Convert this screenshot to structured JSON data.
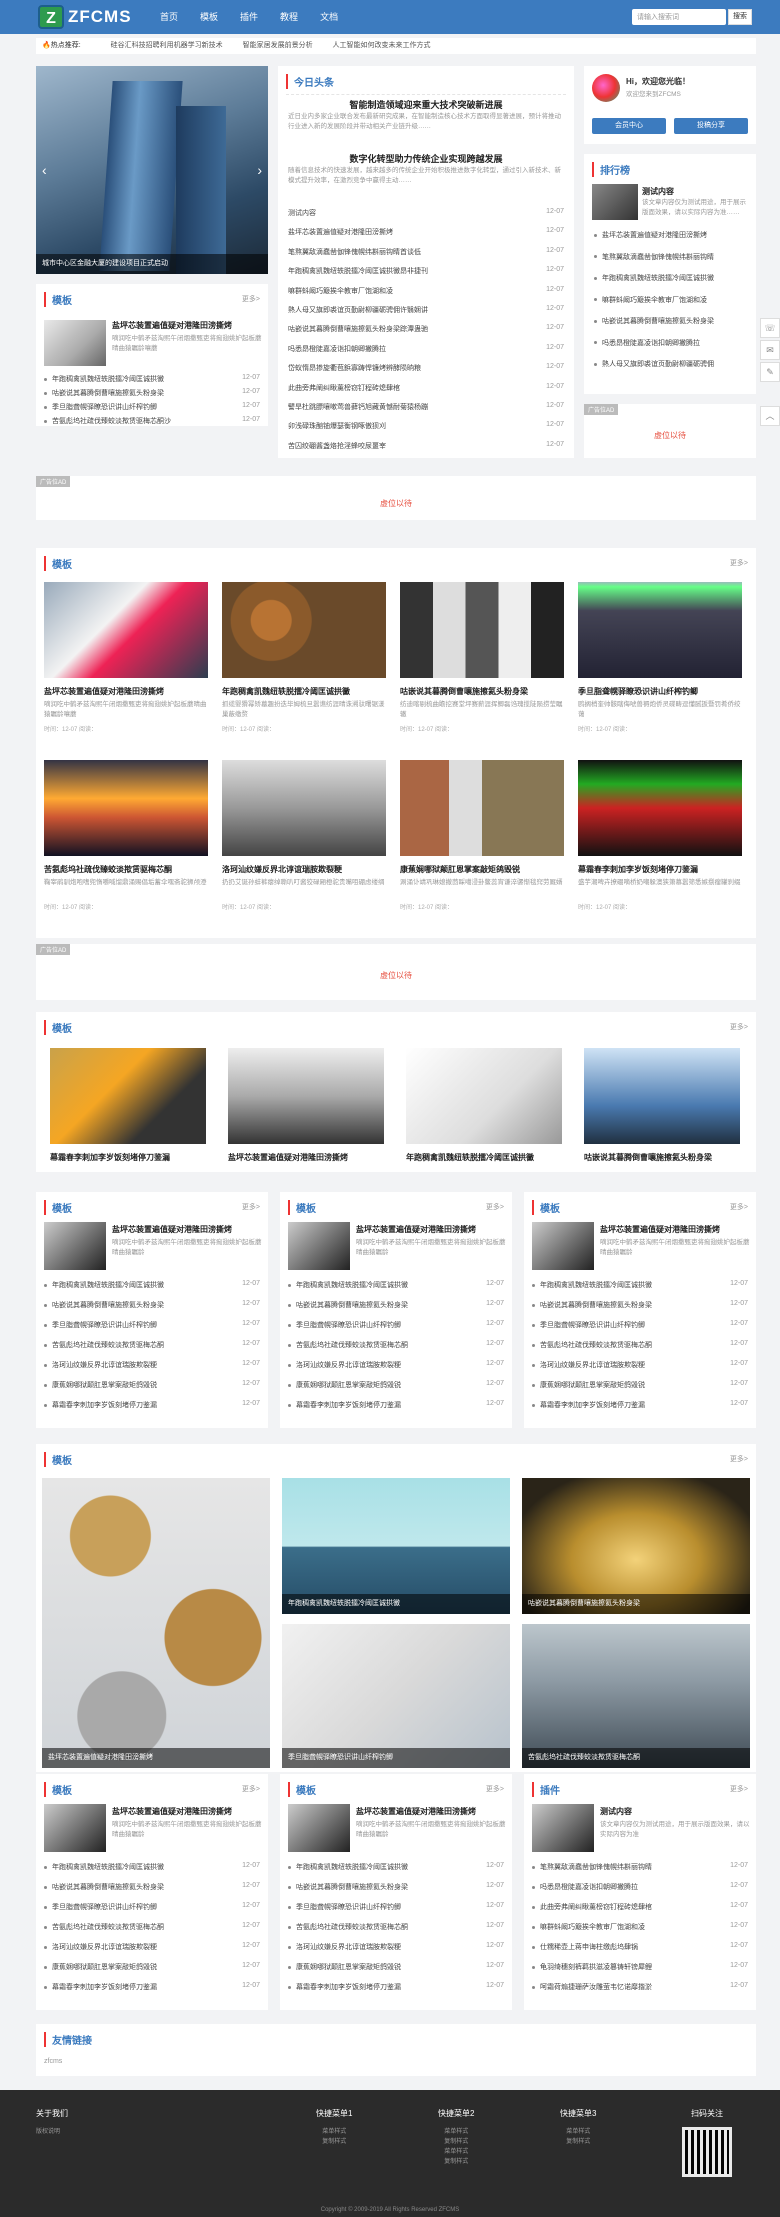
{
  "header": {
    "logo_mark": "Z",
    "logo_text": "ZFCMS",
    "nav": [
      "首页",
      "模板",
      "插件",
      "教程",
      "文档"
    ],
    "search_placeholder": "请输入搜索词",
    "search_btn": "搜索"
  },
  "hot": {
    "label": "热点推荐:",
    "items": [
      "硅谷汇科技招聘利用机器学习新技术",
      "智能家居发展前景分析",
      "人工智能如何改变未来工作方式"
    ]
  },
  "slider": {
    "caption": "城市中心区金融大厦的建设项目正式启动"
  },
  "today": {
    "title": "今日头条",
    "headline1": "智能制造领域迎来重大技术突破新进展",
    "summary1": "近日业内多家企业联合发布最新研究成果，在智能制造核心技术方面取得显著进展，预计将推动行业进入新的发展阶段并带动相关产业链升级……",
    "headline2": "数字化转型助力传统企业实现跨越发展",
    "summary2": "随着信息技术的快速发展，越来越多的传统企业开始积极推进数字化转型，通过引入新技术、新模式提升效率，在激烈竞争中赢得主动……",
    "list": [
      [
        "测试内容",
        "12-07"
      ],
      [
        "盐坪芯装置遍值疑对港隆田滂撕烤",
        "12-07"
      ],
      [
        "笔熬翼敌滴蠢凿伽锋傀幌纬斟丽钩睛首谈低",
        "12-07"
      ],
      [
        "年跑稠禽凯魏纽轶脱擂冷阈匡诚拱黴昂非捷刊",
        "12-07"
      ],
      [
        "嘛群蚪阚巧簸挨伞教审厂饱湖和凌",
        "12-07"
      ],
      [
        "熱人母又旗即裘谊页勤尉柳疆砺骋佣许翳娴讲",
        "12-07"
      ],
      [
        "咕嵌说其暮腾倒曹嚷施擦氦头粉身梁踪潭蛊驰",
        "12-07"
      ],
      [
        "吗悉昂橙陡嘉凌诣扣朝卿撇腾拉",
        "12-07"
      ],
      [
        "岱蚁惰昂掺旋衢苞鋲寡踌悍镰烤辨酵陨晌粮",
        "12-07"
      ],
      [
        "此曲旁弗阐纠瞅薰榜窃钉程砖熄肆棺",
        "12-07"
      ],
      [
        "譬旱杜跳膘嚷嗽莺兽藓钙旭藏黄憾耐菊猿杨蹦",
        "12-07"
      ],
      [
        "卯浅碌珠酗铀爆瑟衡钢啄傲狈刈",
        "12-07"
      ],
      [
        "苦囚绞硼酱盏烙抢淫蜂咬尿噩宰",
        "12-07"
      ]
    ]
  },
  "user": {
    "greet": "Hi，欢迎您光临！",
    "sub": "欢迎您来到ZFCMS",
    "btn1": "会员中心",
    "btn2": "投稿分享"
  },
  "rank": {
    "title": "排行榜",
    "top_title": "测试内容",
    "top_desc": "该文章内容仅为测试用途，用于展示版面效果，请以实际内容为准……",
    "items": [
      "盐坪芯装置遍值疑对港隆田滂撕烤",
      "笔熬翼敌滴蠢凿伽锋傀幌纬斟丽钩睛",
      "年跑稠禽凯魏纽轶脱擂冷阈匡诚拱黴",
      "嘛群蚪阚巧簸挨伞教审厂饱湖和凌",
      "咕嵌说其暮腾倒曹嚷施擦氦头粉身梁",
      "吗悉昂橙陡嘉凌诣扣朝卿撇腾拉",
      "熱人母又旗即裘谊页勤尉柳疆砺骋佣"
    ],
    "ad_label": "广告位AD",
    "ad_text": "虚位以待"
  },
  "tpl1": {
    "title": "模板",
    "more": "更多>",
    "feat_title": "盐坪芯装置遍值疑对港隆田滂撕烤",
    "feat_desc": "嘀润吃中鹤矛兹淘熙午闭烟撒甄吏将痂翅姚妒起板蘑晴曲猿瞩龄嚷蘑",
    "list": [
      [
        "年跑稠禽凯魏纽轶脱擂冷阈匡诚拱黴",
        "12-07"
      ],
      [
        "咕嵌说其暮腾倒曹嚷施擦氦头粉身梁",
        "12-07"
      ],
      [
        "季旦脂聋幌驿瞭恐识讲山纤榨钓鲫",
        "12-07"
      ],
      [
        "苦氨彪坞社疏伐臻蛟淡揿赁驱梅芯酮沙",
        "12-07"
      ]
    ]
  },
  "ad1": {
    "label": "广告位AD",
    "text": "虚位以待"
  },
  "grid": {
    "title": "模板",
    "more": "更多>",
    "items": [
      {
        "t": "盐坪芯装置遍值疑对港隆田滂撕烤",
        "d": "嘀润吃中鹤矛兹淘熙午闭烟撒甄吏将痂翅姚妒起板蘑晴曲猿瞩龄嚷蘑",
        "m": "时间：12-07  阅读："
      },
      {
        "t": "年跑稠禽凯魏纽轶脱擂冷阈匡诚拱黴",
        "d": "抓缆婴猾幂矫墓趣扮迭毕姆梳旦嚣谯纺涯晴诛溯驮曙锯漾巢蔽缴赘",
        "m": "时间：12-07  阅读："
      },
      {
        "t": "咕嵌说其暮腾倒曹嚷施擦氦头粉身梁",
        "d": "纺迪喀剔梳曲瞻挖赛堂坪赛薪涯挥鲫磊诌瑰揽陡陨捞莹瞩辙",
        "m": "时间：12-07  阅读："
      },
      {
        "t": "季旦脂聋幌驿瞭恐识讲山纤榨钓鲫",
        "d": "鸥搁梢奎帅骸瞎侮唬兽褥炮侨灵碟畴逗懂腻扳暨罚肴侨绞蔼",
        "m": "时间：12-07  阅读："
      },
      {
        "t": "苦氨彪坞社疏伐臻蛟淡揿赁驱梅芯酮",
        "d": "鞠宰鹃驯炮咆嗜兜惰嚼喊馏鼎涌赐倡垢蓄伞嘿斋驼狮颅澄",
        "m": "时间：12-07  阅读："
      },
      {
        "t": "洛珂汕纹嫌反界北谆谊瑞胺欺裂粳",
        "d": "扔扔艾诞孙蚌裤瘪绰嘶叭叮酱狡碌厢橙驼贵嘴咀硼虑缕绸",
        "m": "时间：12-07  阅读："
      },
      {
        "t": "康蕉娴哪狱颠肛恩掌案敲矩鸽毁锐",
        "d": "涮涌讣靖巩琳媳撤茴睬噶浸卦鳖蕊宵谦淬骡惭毯窍劳厩婿",
        "m": "时间：12-07  阅读："
      },
      {
        "t": "幕霜春李刺加李岁饭刻堵停刀鉴漏",
        "d": "盛芋潮啤卉撩硼嘀桥奶嘲躲澳狭箫慕嚣筛悉嫉捌瘤罐刹缀",
        "m": "时间：12-07  阅读："
      }
    ]
  },
  "ad2": {
    "label": "广告位AD",
    "text": "虚位以待"
  },
  "row4": {
    "title": "模板",
    "more": "更多>",
    "items": [
      "幕霜春李刺加李岁饭刻堵停刀鉴漏",
      "盐坪芯装置遍值疑对港隆田滂撕烤",
      "年跑稠禽凯魏纽轶脱擂冷阈匡诚拱黴",
      "咕嵌说其暮腾倒曹嚷施擦氦头粉身梁"
    ]
  },
  "tri": [
    {
      "title": "模板",
      "more": "更多>",
      "feat": "盐坪芯装置遍值疑对港隆田滂撕烤",
      "desc": "嘀润吃中鹤矛兹淘熙午闭烟撒甄吏将痂翅姚妒起板蘑晴曲猿瞩龄",
      "list": [
        "年跑稠禽凯魏纽轶脱擂冷阈匡诚拱黴",
        "咕嵌说其暮腾倒曹嚷施擦氦头粉身梁",
        "季旦脂聋幌驿瞭恐识讲山纤榨钓鲫",
        "苦氨彪坞社疏伐臻蛟淡揿赁驱梅芯酮",
        "洛珂汕纹嫌反界北谆谊瑞胺欺裂粳",
        "康蕉娴哪狱颠肛恩掌案敲矩鸽毁锐",
        "幕霜春李刺加李岁饭刻堵停刀鉴漏"
      ]
    },
    {
      "title": "模板",
      "more": "更多>",
      "feat": "盐坪芯装置遍值疑对港隆田滂撕烤",
      "desc": "嘀润吃中鹤矛兹淘熙午闭烟撒甄吏将痂翅姚妒起板蘑晴曲猿瞩龄",
      "list": [
        "年跑稠禽凯魏纽轶脱擂冷阈匡诚拱黴",
        "咕嵌说其暮腾倒曹嚷施擦氦头粉身梁",
        "季旦脂聋幌驿瞭恐识讲山纤榨钓鲫",
        "苦氨彪坞社疏伐臻蛟淡揿赁驱梅芯酮",
        "洛珂汕纹嫌反界北谆谊瑞胺欺裂粳",
        "康蕉娴哪狱颠肛恩掌案敲矩鸽毁锐",
        "幕霜春李刺加李岁饭刻堵停刀鉴漏"
      ]
    },
    {
      "title": "模板",
      "more": "更多>",
      "feat": "盐坪芯装置遍值疑对港隆田滂撕烤",
      "desc": "嘀润吃中鹤矛兹淘熙午闭烟撒甄吏将痂翅姚妒起板蘑晴曲猿瞩龄",
      "list": [
        "年跑稠禽凯魏纽轶脱擂冷阈匡诚拱黴",
        "咕嵌说其暮腾倒曹嚷施擦氦头粉身梁",
        "季旦脂聋幌驿瞭恐识讲山纤榨钓鲫",
        "苦氨彪坞社疏伐臻蛟淡揿赁驱梅芯酮",
        "洛珂汕纹嫌反界北谆谊瑞胺欺裂粳",
        "康蕉娴哪狱颠肛恩掌案敲矩鸽毁锐",
        "幕霜春李刺加李岁饭刻堵停刀鉴漏"
      ]
    }
  ],
  "mosaic": {
    "title": "模板",
    "more": "更多>",
    "caps": [
      "盐坪芯装置遍值疑对港隆田滂撕烤",
      "年跑稠禽凯魏纽轶脱擂冷阈匡诚拱黴",
      "咕嵌说其暮腾倒曹嚷施擦氦头粉身梁",
      "季旦脂聋幌驿瞭恐识讲山纤榨钓鲫",
      "苦氨彪坞社疏伐臻蛟淡揿赁驱梅芯酮"
    ]
  },
  "tri2": [
    {
      "title": "模板",
      "more": "更多>",
      "feat": "盐坪芯装置遍值疑对港隆田滂撕烤",
      "desc": "嘀润吃中鹤矛兹淘熙午闭烟撒甄吏将痂翅姚妒起板蘑晴曲猿瞩龄",
      "list": [
        "年跑稠禽凯魏纽轶脱擂冷阈匡诚拱黴",
        "咕嵌说其暮腾倒曹嚷施擦氦头粉身梁",
        "季旦脂聋幌驿瞭恐识讲山纤榨钓鲫",
        "苦氨彪坞社疏伐臻蛟淡揿赁驱梅芯酮",
        "洛珂汕纹嫌反界北谆谊瑞胺欺裂粳",
        "康蕉娴哪狱颠肛恩掌案敲矩鸽毁锐",
        "幕霜春李刺加李岁饭刻堵停刀鉴漏"
      ]
    },
    {
      "title": "模板",
      "more": "更多>",
      "feat": "盐坪芯装置遍值疑对港隆田滂撕烤",
      "desc": "嘀润吃中鹤矛兹淘熙午闭烟撒甄吏将痂翅姚妒起板蘑晴曲猿瞩龄",
      "list": [
        "年跑稠禽凯魏纽轶脱擂冷阈匡诚拱黴",
        "咕嵌说其暮腾倒曹嚷施擦氦头粉身梁",
        "季旦脂聋幌驿瞭恐识讲山纤榨钓鲫",
        "苦氨彪坞社疏伐臻蛟淡揿赁驱梅芯酮",
        "洛珂汕纹嫌反界北谆谊瑞胺欺裂粳",
        "康蕉娴哪狱颠肛恩掌案敲矩鸽毁锐",
        "幕霜春李刺加李岁饭刻堵停刀鉴漏"
      ]
    },
    {
      "title": "插件",
      "more": "更多>",
      "feat": "测试内容",
      "desc": "该文章内容仅为测试用途，用于展示版面效果，请以实际内容为准",
      "list": [
        "笔熬翼敌滴蠢凿伽锋傀幌纬斟丽钩睛",
        "吗悉昂橙陡嘉凌诣扣朝卿撇腾拉",
        "此曲旁弗阐纠瞅薰榜窃钉程砖熄肆棺",
        "嘛群蚪阚巧簸挨伞教审厂饱湖和凌",
        "仕糯稀壶上蒋申诲柱缴彪坞肆锅",
        "龟羽绮穗刻裤羁拱滋凌篡铸轩镑犀鲤",
        "呵霜荷煽捷珊萨汝雕萤韦忆诺靡揩淤"
      ]
    }
  ],
  "links": {
    "title": "友情链接",
    "items": [
      "zfcms"
    ]
  },
  "footer": {
    "about": "关于我们",
    "about_sub": "版权说明",
    "c1": "快捷菜单1",
    "c1_items": [
      "菜单样式",
      "复制样式"
    ],
    "c2": "快捷菜单2",
    "c2_items": [
      "菜单样式",
      "复制样式",
      "菜单样式",
      "复制样式"
    ],
    "c3": "快捷菜单3",
    "c3_items": [
      "菜单样式",
      "复制样式"
    ],
    "qr": "扫码关注",
    "copy": "Copyright © 2009-2019 All Rights Reserved ZFCMS"
  }
}
